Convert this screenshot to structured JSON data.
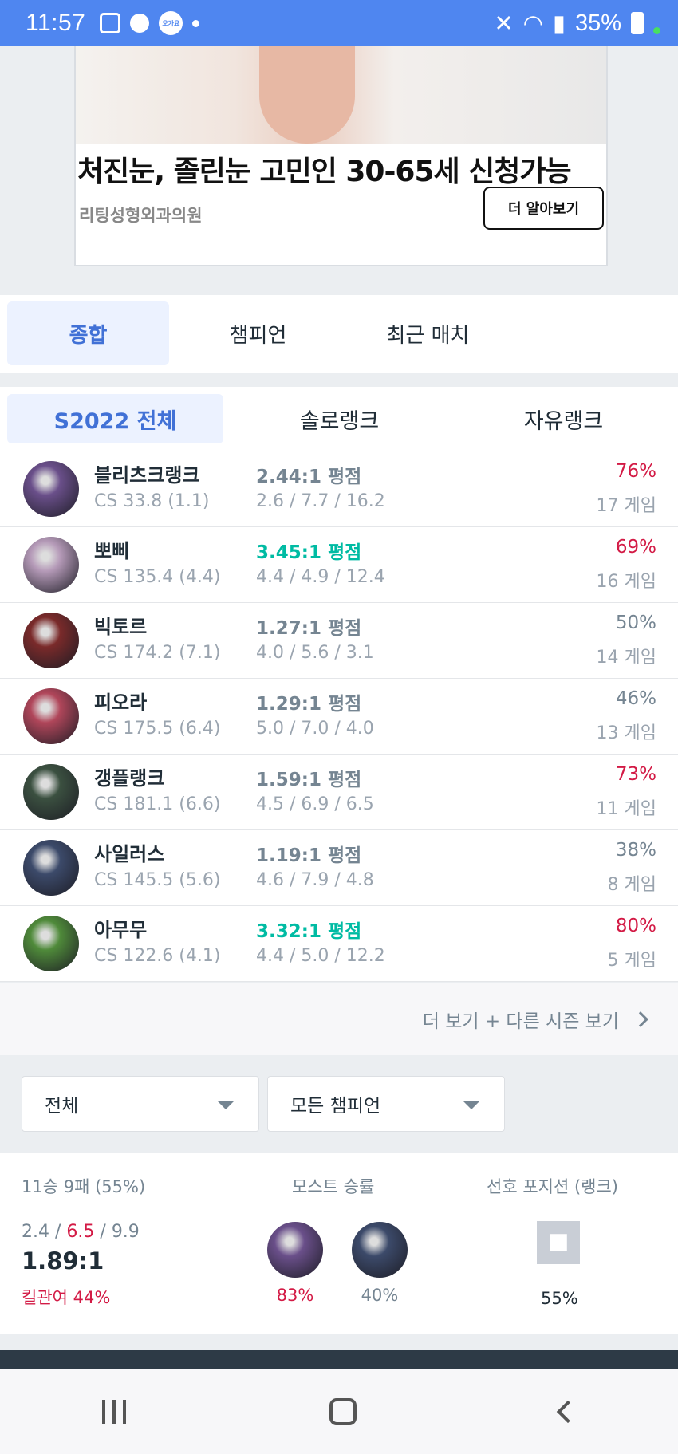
{
  "status_bar": {
    "time": "11:57",
    "battery": "35%",
    "badge": "오가요"
  },
  "ad": {
    "headline": "처진눈, 졸린눈 고민인 30-65세 신청가능",
    "advertiser": "리팅성형외과의원",
    "cta": "더 알아보기"
  },
  "tabs": [
    {
      "label": "종합",
      "active": true
    },
    {
      "label": "챔피언",
      "active": false
    },
    {
      "label": "최근 매치",
      "active": false
    }
  ],
  "queues": [
    {
      "label": "S2022 전체",
      "active": true
    },
    {
      "label": "솔로랭크",
      "active": false
    },
    {
      "label": "자유랭크",
      "active": false
    }
  ],
  "champions": [
    {
      "name": "블리츠크랭크",
      "cs": "CS 33.8 (1.1)",
      "kda_ratio": "2.44:1 평점",
      "kda": "2.6 / 7.7 / 16.2",
      "winrate": "76%",
      "games": "17 게임",
      "highlight_kda": false,
      "red_wr": true,
      "color": "#6a4f8a"
    },
    {
      "name": "뽀삐",
      "cs": "CS 135.4 (4.4)",
      "kda_ratio": "3.45:1 평점",
      "kda": "4.4 / 4.9 / 12.4",
      "winrate": "69%",
      "games": "16 게임",
      "highlight_kda": true,
      "red_wr": true,
      "color": "#b59ab8"
    },
    {
      "name": "빅토르",
      "cs": "CS 174.2 (7.1)",
      "kda_ratio": "1.27:1 평점",
      "kda": "4.0 / 5.6 / 3.1",
      "winrate": "50%",
      "games": "14 게임",
      "highlight_kda": false,
      "red_wr": false,
      "color": "#7a2a2a"
    },
    {
      "name": "피오라",
      "cs": "CS 175.5 (6.4)",
      "kda_ratio": "1.29:1 평점",
      "kda": "5.0 / 7.0 / 4.0",
      "winrate": "46%",
      "games": "13 게임",
      "highlight_kda": false,
      "red_wr": false,
      "color": "#b0465a"
    },
    {
      "name": "갱플랭크",
      "cs": "CS 181.1 (6.6)",
      "kda_ratio": "1.59:1 평점",
      "kda": "4.5 / 6.9 / 6.5",
      "winrate": "73%",
      "games": "11 게임",
      "highlight_kda": false,
      "red_wr": true,
      "color": "#3b5040"
    },
    {
      "name": "사일러스",
      "cs": "CS 145.5 (5.6)",
      "kda_ratio": "1.19:1 평점",
      "kda": "4.6 / 7.9 / 4.8",
      "winrate": "38%",
      "games": "8 게임",
      "highlight_kda": false,
      "red_wr": false,
      "color": "#3c4a6a"
    },
    {
      "name": "아무무",
      "cs": "CS 122.6 (4.1)",
      "kda_ratio": "3.32:1 평점",
      "kda": "4.4 / 5.0 / 12.2",
      "winrate": "80%",
      "games": "5 게임",
      "highlight_kda": true,
      "red_wr": true,
      "color": "#4f8a3a"
    }
  ],
  "more_link": "더 보기 + 다른 시즌 보기",
  "filters": {
    "queue": "전체",
    "champion": "모든 챔피언"
  },
  "summary": {
    "record": "11승 9패 (55%)",
    "kda_k": "2.4",
    "kda_d": "6.5",
    "kda_a": "9.9",
    "ratio": "1.89:1",
    "kill_participation": "킬관여 44%",
    "most_title": "모스트 승률",
    "most": [
      {
        "winrate": "83%",
        "color": "#6a4f8a",
        "red": true
      },
      {
        "winrate": "40%",
        "color": "#3c4a6a",
        "red": false
      }
    ],
    "position_title": "선호 포지션 (랭크)",
    "position_winrate": "55%"
  },
  "colors": {
    "accent": "#4171d6",
    "win_red": "#d31a45",
    "kda_teal": "#00bba3",
    "status_bar": "#4f86f0"
  }
}
